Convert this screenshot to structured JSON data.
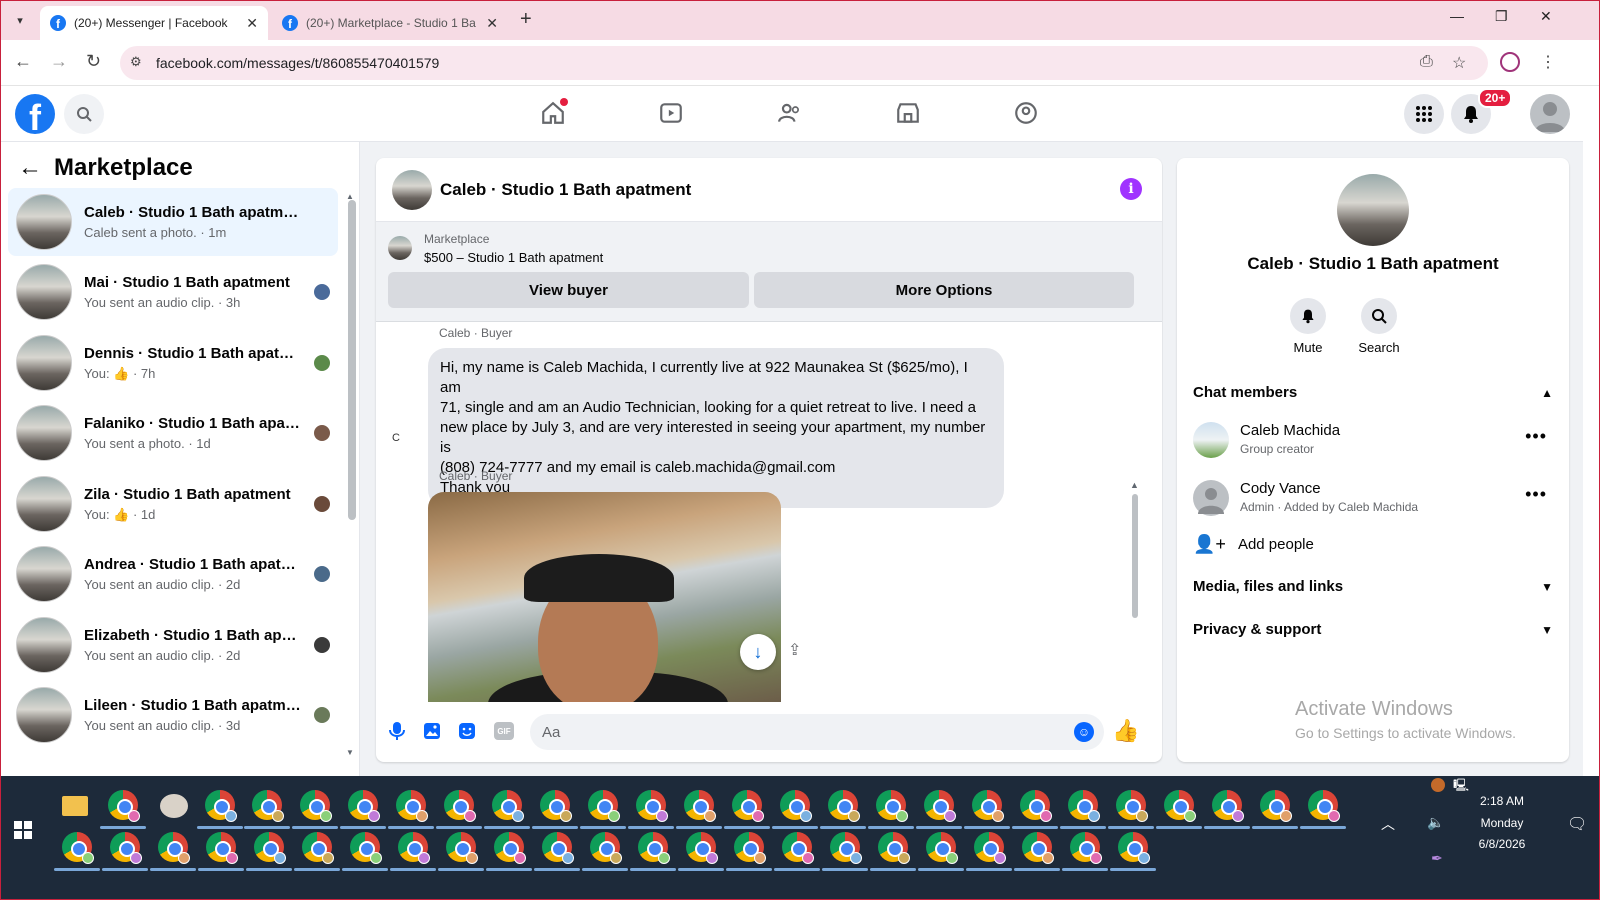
{
  "browser": {
    "tabs": [
      {
        "title": "(20+) Messenger | Facebook",
        "active": true
      },
      {
        "title": "(20+) Marketplace - Studio 1 Ba",
        "active": false
      }
    ],
    "url": "facebook.com/messages/t/860855470401579"
  },
  "fb_nav": {
    "notification_count": "20+",
    "icons": [
      "home-icon",
      "video-icon",
      "friends-icon",
      "marketplace-icon",
      "groups-icon"
    ]
  },
  "sidebar": {
    "title": "Marketplace",
    "conversations": [
      {
        "name": "Caleb · Studio 1 Bath apatment",
        "preview": "Caleb sent a photo. · 1m",
        "selected": true
      },
      {
        "name": "Mai · Studio 1 Bath apatment",
        "preview": "You sent an audio clip. · 3h"
      },
      {
        "name": "Dennis · Studio 1 Bath apatme...",
        "preview": "You: 👍 · 7h"
      },
      {
        "name": "Falaniko · Studio 1 Bath apatm...",
        "preview": "You sent a photo. · 1d"
      },
      {
        "name": "Zila · Studio 1 Bath apatment",
        "preview": "You: 👍 · 1d"
      },
      {
        "name": "Andrea · Studio 1 Bath apatm...",
        "preview": "You sent an audio clip. · 2d"
      },
      {
        "name": "Elizabeth · Studio 1 Bath apat...",
        "preview": "You sent an audio clip. · 2d"
      },
      {
        "name": "Lileen · Studio 1 Bath apatment",
        "preview": "You sent an audio clip. · 3d"
      }
    ]
  },
  "chat": {
    "title": "Caleb · Studio 1 Bath apatment",
    "listing_label": "Marketplace",
    "listing_price": "$500 – Studio 1 Bath apatment",
    "view_buyer": "View buyer",
    "more_options": "More Options",
    "sender_label_1": "Caleb · Buyer",
    "message_lines": [
      "Hi, my name is Caleb Machida, I currently live at 922 Maunakea St ($625/mo), I am",
      "71, single and am an Audio Technician, looking for a quiet retreat to live. I need a",
      "new place by July 3, and are very interested in seeing your apartment, my number is",
      "(808) 724-7777 and my email is caleb.machida@gmail.com",
      "Thank you"
    ],
    "sender_label_2": "Caleb · Buyer",
    "broken_avatar_alt": "C",
    "input_placeholder": "Aa",
    "gif_label": "GIF"
  },
  "info_panel": {
    "name": "Caleb · Studio 1 Bath apatment",
    "actions": [
      {
        "label": "Mute",
        "icon": "bell-icon"
      },
      {
        "label": "Search",
        "icon": "search-icon"
      }
    ],
    "chat_members_label": "Chat members",
    "members": [
      {
        "name": "Caleb Machida",
        "role": "Group creator"
      },
      {
        "name": "Cody Vance",
        "role": "Admin · Added by Caleb Machida"
      }
    ],
    "add_people": "Add people",
    "media_label": "Media, files and links",
    "privacy_label": "Privacy & support"
  },
  "watermark": {
    "line1": "Activate Windows",
    "line2": "Go to Settings to activate Windows."
  },
  "taskbar": {
    "time": "2:18 AM",
    "day": "Monday",
    "date": "6/8/2026"
  },
  "colors": {
    "fb_blue": "#1877f2",
    "messenger_blue": "#0866ff",
    "info_purple": "#a033ff",
    "badge_red": "#e41e3f"
  }
}
